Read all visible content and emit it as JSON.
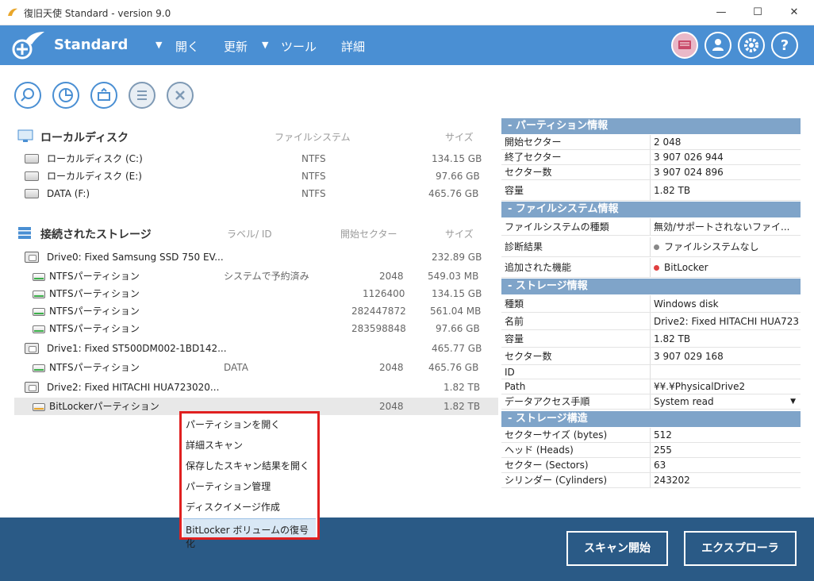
{
  "window": {
    "title": "復旧天使 Standard - version 9.0",
    "minimize": "—",
    "maximize": "☐",
    "close": "✕"
  },
  "header": {
    "app_name": "Standard",
    "menu": [
      "開く",
      "更新",
      "ツール",
      "詳細"
    ]
  },
  "local_disk": {
    "title": "ローカルディスク",
    "col_fs": "ファイルシステム",
    "col_size": "サイズ",
    "rows": [
      {
        "name": "ローカルディスク (C:)",
        "fs": "NTFS",
        "size": "134.15 GB"
      },
      {
        "name": "ローカルディスク (E:)",
        "fs": "NTFS",
        "size": "97.66 GB"
      },
      {
        "name": "DATA (F:)",
        "fs": "NTFS",
        "size": "465.76 GB"
      }
    ]
  },
  "storage": {
    "title": "接続されたストレージ",
    "col_label": "ラベル/ ID",
    "col_start": "開始セクター",
    "col_size": "サイズ",
    "rows": [
      {
        "name": "Drive0: Fixed Samsung SSD 750 EV...",
        "label": "",
        "start": "",
        "size": "232.89 GB"
      },
      {
        "name": "NTFSパーティション",
        "label": "システムで予約済み",
        "start": "2048",
        "size": "549.03 MB"
      },
      {
        "name": "NTFSパーティション",
        "label": "",
        "start": "1126400",
        "size": "134.15 GB"
      },
      {
        "name": "NTFSパーティション",
        "label": "",
        "start": "282447872",
        "size": "561.04 MB"
      },
      {
        "name": "NTFSパーティション",
        "label": "",
        "start": "283598848",
        "size": "97.66 GB"
      },
      {
        "name": "Drive1: Fixed ST500DM002-1BD142...",
        "label": "",
        "start": "",
        "size": "465.77 GB"
      },
      {
        "name": "NTFSパーティション",
        "label": "DATA",
        "start": "2048",
        "size": "465.76 GB"
      },
      {
        "name": "Drive2: Fixed HITACHI HUA723020...",
        "label": "",
        "start": "",
        "size": "1.82 TB"
      },
      {
        "name": "BitLockerパーティション",
        "label": "",
        "start": "2048",
        "size": "1.82 TB"
      }
    ]
  },
  "context_menu": [
    "パーティションを開く",
    "詳細スキャン",
    "保存したスキャン結果を開く",
    "パーティション管理",
    "ディスクイメージ作成",
    "BitLocker ボリュームの復号化"
  ],
  "info": {
    "partition": {
      "title": "-  パーティション情報",
      "rows": [
        {
          "k": "開始セクター",
          "v": "2 048"
        },
        {
          "k": "終了セクター",
          "v": "3 907 026 944"
        },
        {
          "k": "セクター数",
          "v": "3 907 024 896"
        },
        {
          "k": "容量",
          "v": "1.82 TB"
        }
      ]
    },
    "filesystem": {
      "title": "-  ファイルシステム情報",
      "rows": [
        {
          "k": "ファイルシステムの種類",
          "v": "無効/サポートされないファイ..."
        },
        {
          "k": "診断結果",
          "v": "ファイルシステムなし",
          "dot": "#888888"
        },
        {
          "k": "追加された機能",
          "v": "BitLocker",
          "dot": "#e04040"
        }
      ]
    },
    "storage": {
      "title": "-  ストレージ情報",
      "rows": [
        {
          "k": "種類",
          "v": "Windows disk"
        },
        {
          "k": "名前",
          "v": "Drive2: Fixed HITACHI HUA723"
        },
        {
          "k": "容量",
          "v": "1.82 TB"
        },
        {
          "k": "セクター数",
          "v": "3 907 029 168"
        },
        {
          "k": "ID",
          "v": ""
        },
        {
          "k": "Path",
          "v": "¥¥.¥PhysicalDrive2"
        },
        {
          "k": "データアクセス手順",
          "v": "System read"
        }
      ]
    },
    "structure": {
      "title": "-  ストレージ構造",
      "rows": [
        {
          "k": "セクターサイズ (bytes)",
          "v": "512"
        },
        {
          "k": "ヘッド (Heads)",
          "v": "255"
        },
        {
          "k": "セクター (Sectors)",
          "v": "63"
        },
        {
          "k": "シリンダー (Cylinders)",
          "v": "243202"
        }
      ]
    }
  },
  "footer": {
    "scan": "スキャン開始",
    "explorer": "エクスプローラ"
  }
}
